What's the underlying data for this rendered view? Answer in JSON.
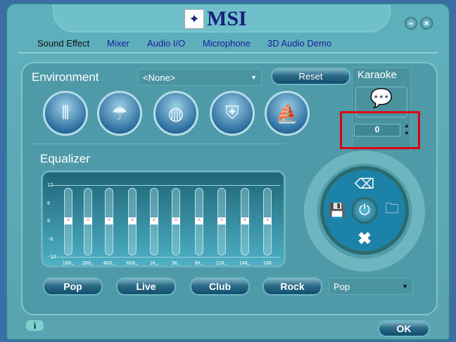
{
  "header": {
    "logo_text": "MSI",
    "minimize_label": "–",
    "close_label": "×"
  },
  "tabs": [
    "Sound Effect",
    "Mixer",
    "Audio I/O",
    "Microphone",
    "3D Audio Demo"
  ],
  "environment": {
    "label": "Environment",
    "selected": "<None>",
    "reset_label": "Reset",
    "icons": [
      "bathroom-icon",
      "shower-icon",
      "stadium-icon",
      "castle-icon",
      "opera-house-icon"
    ]
  },
  "karaoke": {
    "label": "Karaoke",
    "value": "0"
  },
  "equalizer": {
    "label": "Equalizer",
    "y_ticks": [
      "12",
      "6",
      "0",
      "-6",
      "-12"
    ],
    "bands": [
      {
        "freq": "100,",
        "gain": 0
      },
      {
        "freq": "200,",
        "gain": 0
      },
      {
        "freq": "400,",
        "gain": 0
      },
      {
        "freq": "600,",
        "gain": 0
      },
      {
        "freq": "1K,",
        "gain": 0
      },
      {
        "freq": "3K,",
        "gain": 0
      },
      {
        "freq": "6K,",
        "gain": 0
      },
      {
        "freq": "12K,",
        "gain": 0
      },
      {
        "freq": "14K,",
        "gain": 0
      },
      {
        "freq": "16K",
        "gain": 0
      }
    ],
    "presets": [
      "Pop",
      "Live",
      "Club",
      "Rock"
    ],
    "preset_selected": "Pop"
  },
  "ok_label": "OK",
  "colors": {
    "highlight": "#e00010",
    "panel": "#4f9aa8"
  }
}
